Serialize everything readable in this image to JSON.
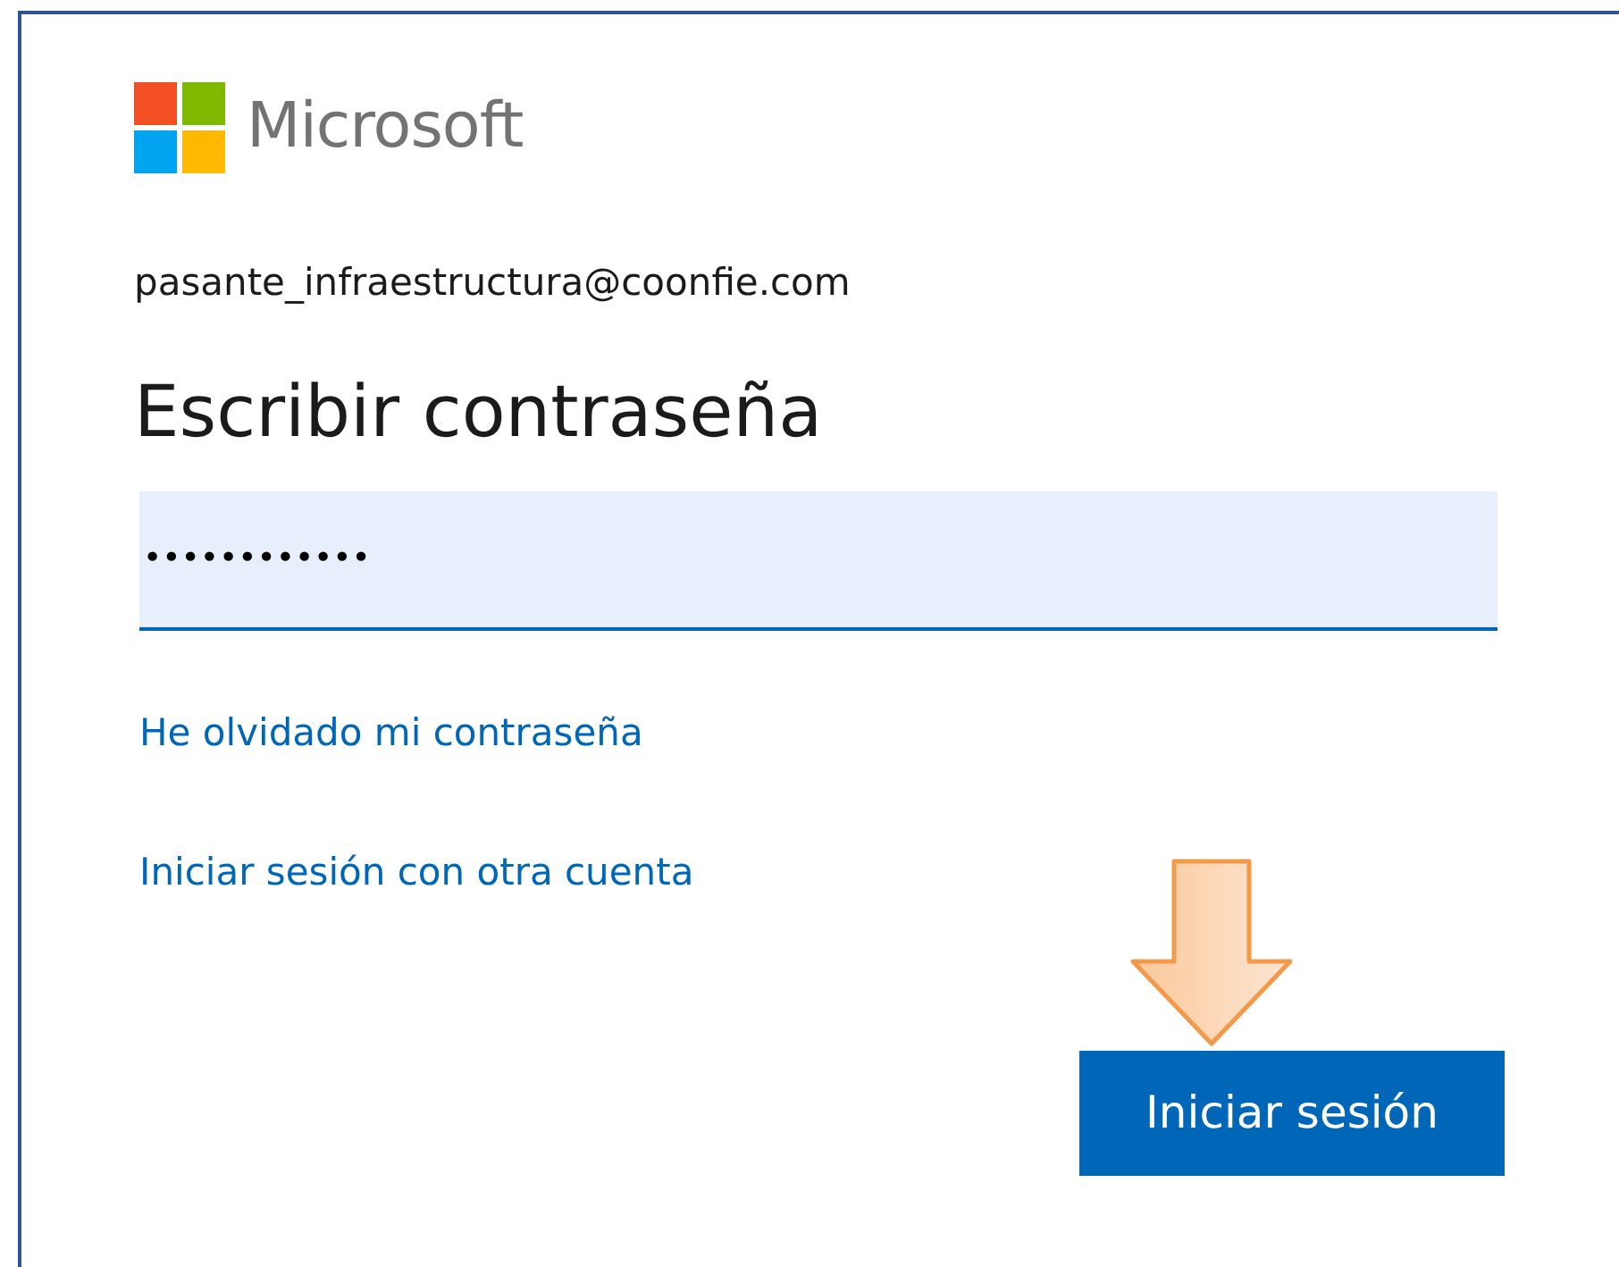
{
  "brand": {
    "name": "Microsoft"
  },
  "account": "pasante_infraestructura@coonfie.com",
  "heading": "Escribir contraseña",
  "password_field": {
    "value": "••••••••••••",
    "focused": true
  },
  "links": [
    "He olvidado mi contraseña",
    "Iniciar sesión con otra cuenta"
  ],
  "submit_button": "Iniciar sesión",
  "annotation": {
    "kind": "arrow"
  }
}
